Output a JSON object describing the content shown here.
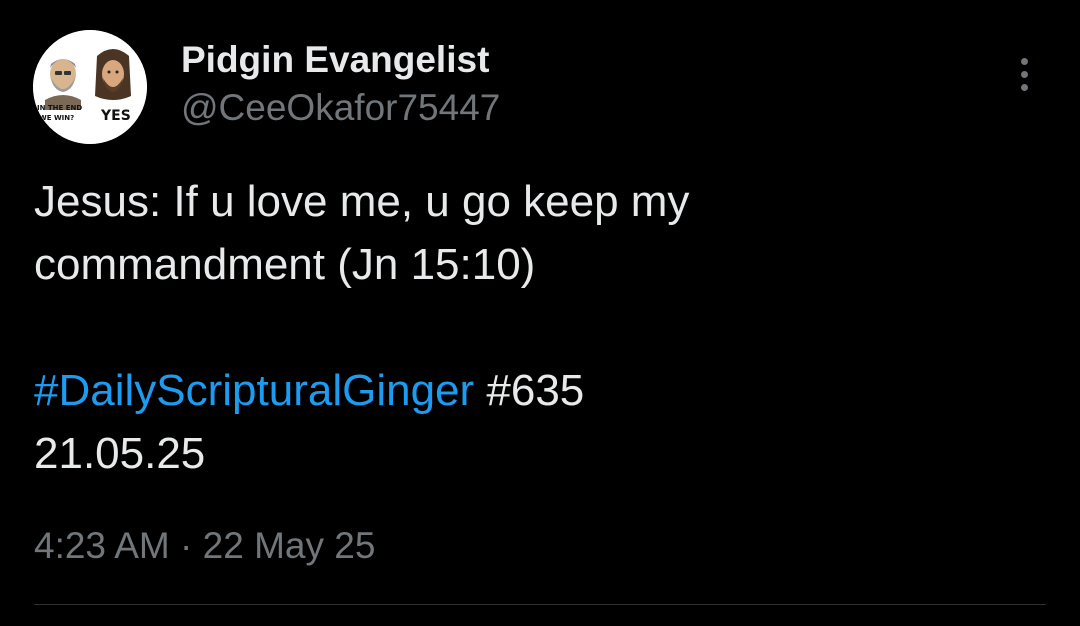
{
  "tweet": {
    "author": {
      "display_name": "Pidgin Evangelist",
      "handle": "@CeeOkafor75447",
      "avatar": {
        "left_text_line1": "IN THE END",
        "left_text_line2": "WE WIN?",
        "right_text": "YES"
      }
    },
    "more_icon": "more-vertical-icon",
    "text_lines": [
      "Jesus: If u love me, u go keep my",
      "commandment (Jn 15:10)"
    ],
    "hashtag": "#DailyScripturalGinger",
    "hashtag_suffix": " #635",
    "date_line": "21.05.25",
    "timestamp": "4:23 AM · 22 May 25"
  },
  "colors": {
    "background": "#000000",
    "text_primary": "#e7e9ea",
    "text_secondary": "#71767b",
    "link": "#1d9bf0",
    "divider": "#2f3336"
  }
}
